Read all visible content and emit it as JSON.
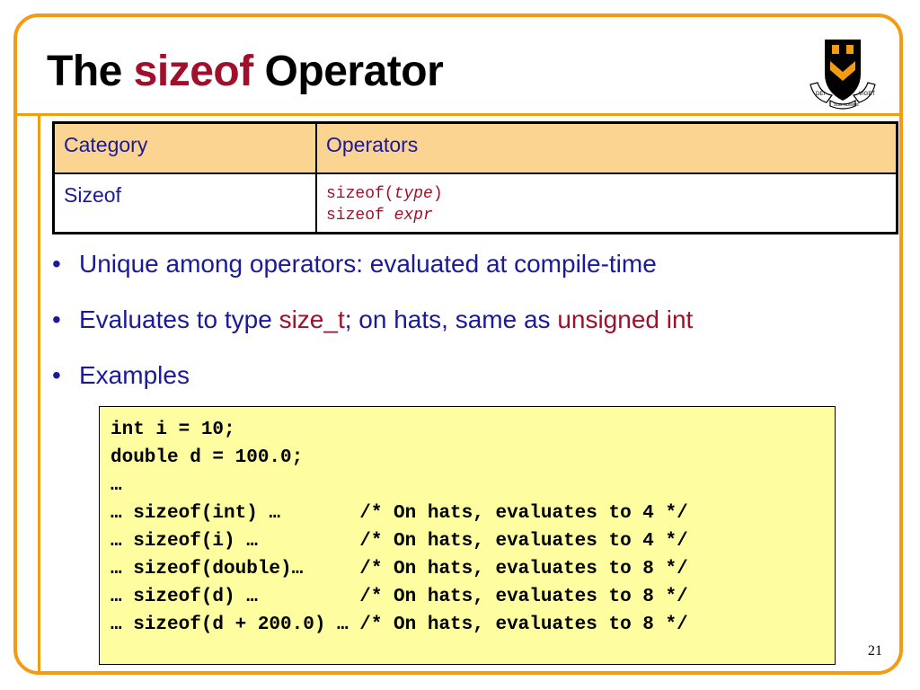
{
  "slide": {
    "title_part1": "The ",
    "title_accent": "sizeof",
    "title_part2": " Operator",
    "page_number": "21",
    "logo_text": {
      "left": "DEI",
      "middle": "SUB NUMINE",
      "right": "VIGET"
    }
  },
  "table": {
    "headers": [
      "Category",
      "Operators"
    ],
    "row": {
      "category": "Sizeof",
      "op1_code": "sizeof(",
      "op1_italic": "type",
      "op1_close": ")",
      "op2_code": "sizeof ",
      "op2_italic": "expr"
    }
  },
  "bullets": [
    {
      "text": "Unique among operators:  evaluated at compile-time"
    },
    {
      "pre": "Evaluates to type ",
      "red1": "size_t",
      "mid": "; on hats, same as ",
      "red2": "unsigned int"
    },
    {
      "text": "Examples"
    }
  ],
  "code_lines": [
    "int i = 10;",
    "double d = 100.0;",
    "…",
    "… sizeof(int) …       /* On hats, evaluates to 4 */",
    "… sizeof(i) …         /* On hats, evaluates to 4 */",
    "… sizeof(double)…     /* On hats, evaluates to 8 */",
    "… sizeof(d) …         /* On hats, evaluates to 8 */",
    "… sizeof(d + 200.0) … /* On hats, evaluates to 8 */"
  ],
  "colors": {
    "accent_orange": "#f39c12",
    "title_red": "#a0102a",
    "text_blue": "#1a1a9c",
    "table_header_bg": "#fcd491",
    "code_bg": "#fefea0"
  }
}
